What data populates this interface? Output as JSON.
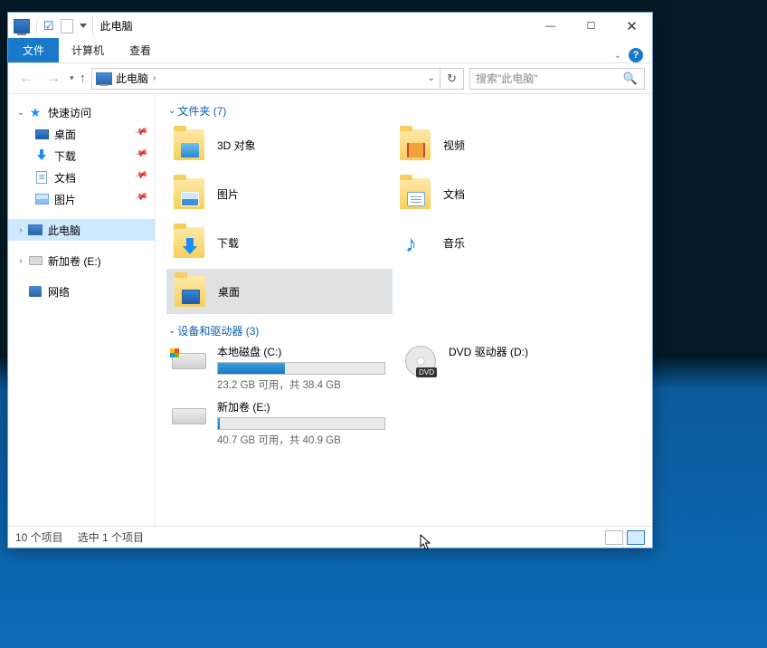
{
  "titlebar": {
    "title": "此电脑"
  },
  "menubar": {
    "file": "文件",
    "computer": "计算机",
    "view": "查看"
  },
  "nav": {
    "address_root": "此电脑",
    "search_placeholder": "搜索\"此电脑\""
  },
  "sidebar": {
    "quick_access": "快速访问",
    "desktop": "桌面",
    "downloads": "下载",
    "documents": "文档",
    "pictures": "图片",
    "this_pc": "此电脑",
    "volume_e": "新加卷 (E:)",
    "network": "网络"
  },
  "sections": {
    "folders_header": "文件夹 (7)",
    "devices_header": "设备和驱动器 (3)"
  },
  "folders": {
    "objects3d": "3D 对象",
    "video": "视频",
    "pictures": "图片",
    "documents": "文档",
    "downloads": "下载",
    "music": "音乐",
    "desktop": "桌面"
  },
  "drives": {
    "c": {
      "name": "本地磁盘 (C:)",
      "subtitle": "23.2 GB 可用，共 38.4 GB",
      "fill_pct": 40
    },
    "d": {
      "name": "DVD 驱动器 (D:)",
      "badge": "DVD"
    },
    "e": {
      "name": "新加卷 (E:)",
      "subtitle": "40.7 GB 可用，共 40.9 GB",
      "fill_pct": 1
    }
  },
  "statusbar": {
    "items": "10 个项目",
    "selected": "选中 1 个项目"
  }
}
